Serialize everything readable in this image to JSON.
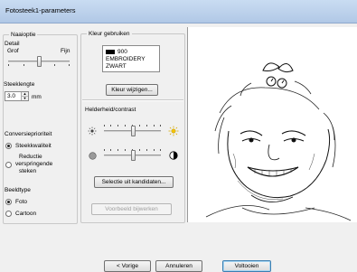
{
  "window": {
    "title": "Fotosteek1-parameters"
  },
  "naaioptie": {
    "caption": "Naaioptie",
    "detail_label": "Detail",
    "coarse_label": "Grof",
    "fine_label": "Fijn",
    "detail_level": 0.5,
    "stitch_length_label": "Steeklengte",
    "stitch_length_value": "3.0",
    "stitch_length_unit": "mm",
    "priority_label": "Conversieprioriteit",
    "priority_options": [
      "Steekkwaliteit",
      "Reductie verspringende steken"
    ],
    "priority_option_2_lines": [
      "Reductie",
      "verspringende",
      "steken"
    ],
    "priority_selected": "Steekkwaliteit",
    "image_type_label": "Beeldtype",
    "image_type_options": [
      "Foto",
      "Cartoon"
    ],
    "image_type_selected": "Foto"
  },
  "kleur": {
    "caption": "Kleur gebruiken",
    "color_code": "900",
    "color_brand": "EMBROIDERY",
    "color_name": "ZWART",
    "swatch_color": "#000000",
    "change_color_button": "Kleur wijzigen...",
    "brightness_contrast_label": "Helderheid/contrast",
    "brightness_level": 0.5,
    "contrast_level": 0.5,
    "select_candidates_button": "Selectie uit kandidaten...",
    "edit_preview_button": "Voorbeeld bijwerken"
  },
  "footer": {
    "back_button": "< Vorige",
    "cancel_button": "Annuleren",
    "finish_button": "Voltooien"
  }
}
